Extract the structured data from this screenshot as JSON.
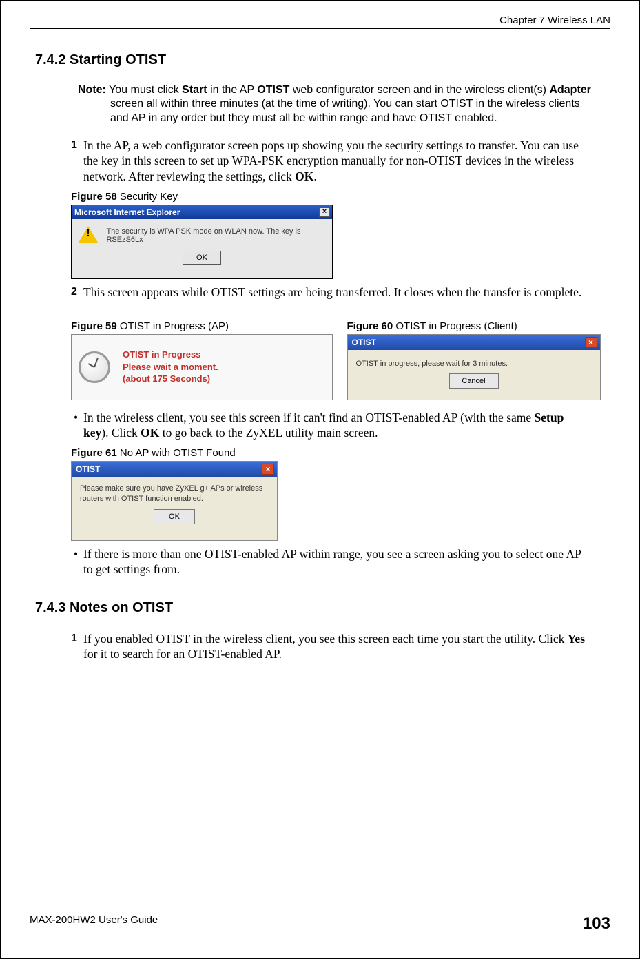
{
  "header": {
    "chapter": "Chapter 7 Wireless LAN"
  },
  "section742": {
    "heading": "7.4.2  Starting OTIST",
    "note_label": "Note:",
    "note_body": " You must click ",
    "note_b1": "Start",
    "note_mid1": " in the AP ",
    "note_b2": "OTIST",
    "note_mid2": " web configurator screen and in the wireless client(s) ",
    "note_b3": "Adapter",
    "note_end": " screen all within three minutes (at the time of writing). You can start OTIST in the wireless clients and AP in any order but they must all be within range and have OTIST enabled.",
    "step1_num": "1",
    "step1_body_a": "In the AP, a web configurator screen pops up showing you the security settings to transfer. You can use the key in this screen to set up WPA-PSK encryption manually for non-OTIST devices in the wireless network. After reviewing the settings, click ",
    "step1_body_b": "OK",
    "step1_body_c": "."
  },
  "fig58": {
    "caption_b": "Figure 58   ",
    "caption": "Security Key",
    "title": "Microsoft Internet Explorer",
    "msg": "The security is WPA PSK mode on WLAN now. The key is RSEzS6Lx",
    "ok": "OK"
  },
  "step2": {
    "num": "2",
    "body": "This screen appears while OTIST settings are being transferred. It closes when the transfer is complete."
  },
  "fig59": {
    "caption_b": "Figure 59   ",
    "caption": "OTIST in Progress (AP)",
    "line1": "OTIST in Progress",
    "line2": "Please wait a moment.",
    "line3": "(about 175  Seconds)"
  },
  "fig60": {
    "caption_b": "Figure 60   ",
    "caption": "OTIST in Progress (Client)",
    "title": "OTIST",
    "msg": "OTIST in progress, please wait for 3 minutes.",
    "cancel": "Cancel"
  },
  "bullet1": {
    "a": "In the wireless client, you see this screen if it can't find an OTIST-enabled AP (with the same ",
    "b": "Setup key",
    "c": "). Click ",
    "d": "OK",
    "e": " to go back to the ZyXEL utility main screen."
  },
  "fig61": {
    "caption_b": "Figure 61   ",
    "caption": "No AP with OTIST Found",
    "title": "OTIST",
    "msg": "Please make sure you have ZyXEL g+ APs or wireless routers with OTIST function enabled.",
    "ok": "OK"
  },
  "bullet2": "If there is more than one OTIST-enabled AP within range, you see a screen asking you to select one AP to get settings from.",
  "section743": {
    "heading": "7.4.3  Notes on OTIST",
    "step1_num": "1",
    "step1_a": "If you enabled OTIST in the wireless client, you see this screen each time you start the utility. Click ",
    "step1_b": "Yes",
    "step1_c": " for it to search for an OTIST-enabled AP."
  },
  "footer": {
    "left": "MAX-200HW2 User's Guide",
    "right": "103"
  }
}
